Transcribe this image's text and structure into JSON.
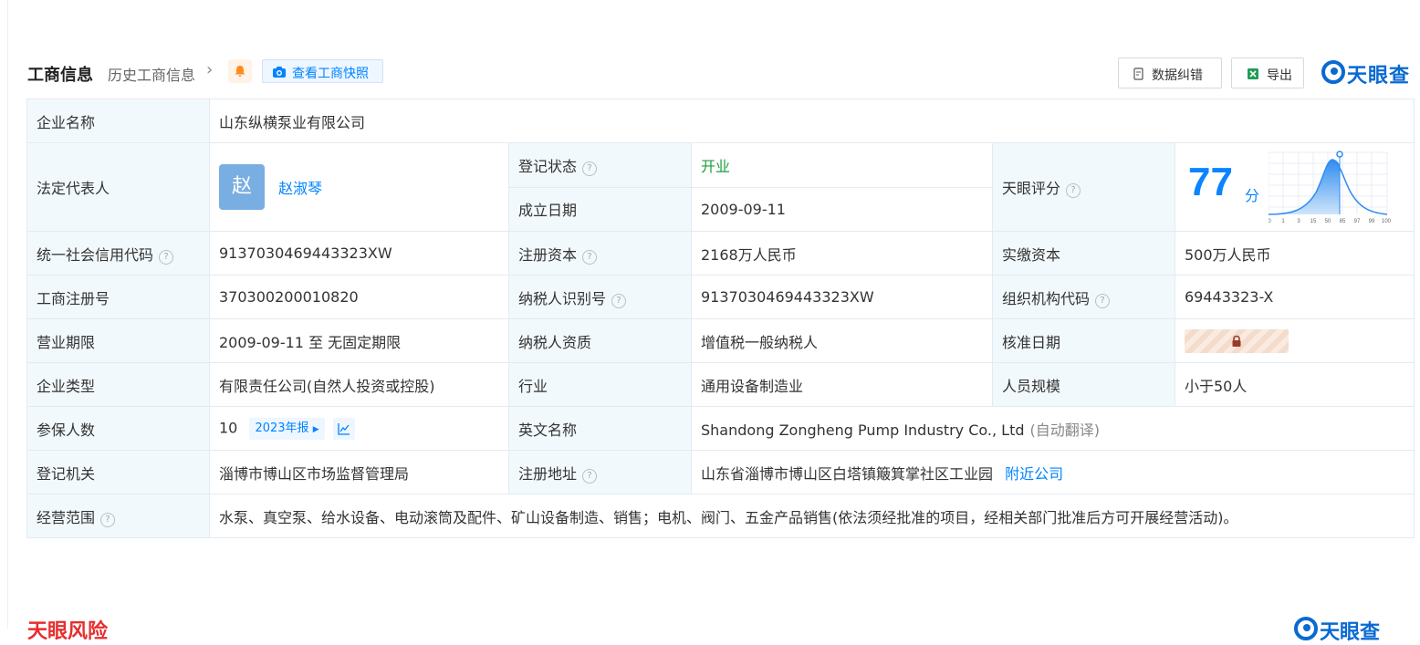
{
  "header": {
    "title": "工商信息",
    "history_link": "历史工商信息",
    "snapshot_button": "查看工商快照",
    "correction_button": "数据纠错",
    "export_button": "导出",
    "brand": "天眼查"
  },
  "company": {
    "name_label": "企业名称",
    "name": "山东纵横泵业有限公司",
    "legal_rep_label": "法定代表人",
    "legal_rep_avatar": "赵",
    "legal_rep": "赵淑琴",
    "status_label": "登记状态",
    "status": "开业",
    "founded_label": "成立日期",
    "founded": "2009-09-11",
    "score_label": "天眼评分",
    "score": "77",
    "score_unit": "分",
    "score_axis": [
      "0",
      "1",
      "3",
      "15",
      "50",
      "85",
      "97",
      "99",
      "100"
    ],
    "credit_code_label": "统一社会信用代码",
    "credit_code": "9137030469443323XW",
    "reg_capital_label": "注册资本",
    "reg_capital": "2168万人民币",
    "paid_capital_label": "实缴资本",
    "paid_capital": "500万人民币",
    "reg_no_label": "工商注册号",
    "reg_no": "370300200010820",
    "taxpayer_id_label": "纳税人识别号",
    "taxpayer_id": "9137030469443323XW",
    "org_code_label": "组织机构代码",
    "org_code": "69443323-X",
    "term_label": "营业期限",
    "term": "2009-09-11 至 无固定期限",
    "tax_qual_label": "纳税人资质",
    "tax_qual": "增值税一般纳税人",
    "approval_label": "核准日期",
    "type_label": "企业类型",
    "type": "有限责任公司(自然人投资或控股)",
    "industry_label": "行业",
    "industry": "通用设备制造业",
    "staff_label": "人员规模",
    "staff": "小于50人",
    "insured_label": "参保人数",
    "insured": "10",
    "insured_report": "2023年报",
    "english_label": "英文名称",
    "english": "Shandong Zongheng Pump Industry Co., Ltd",
    "english_note": "(自动翻译)",
    "authority_label": "登记机关",
    "authority": "淄博市博山区市场监督管理局",
    "address_label": "注册地址",
    "address": "山东省淄博市博山区白塔镇簸箕掌社区工业园",
    "nearby": "附近公司",
    "scope_label": "经营范围",
    "scope": "水泵、真空泵、给水设备、电动滚筒及配件、矿山设备制造、销售；电机、阀门、五金产品销售(依法须经批准的项目，经相关部门批准后方可开展经营活动)。"
  },
  "footer": {
    "risk_title": "天眼风险",
    "brand": "天眼查"
  },
  "colors": {
    "accent": "#0084ff",
    "label_bg": "#f2f9fc",
    "status_green": "#1b9e3e",
    "risk_red": "#e62e2e"
  }
}
